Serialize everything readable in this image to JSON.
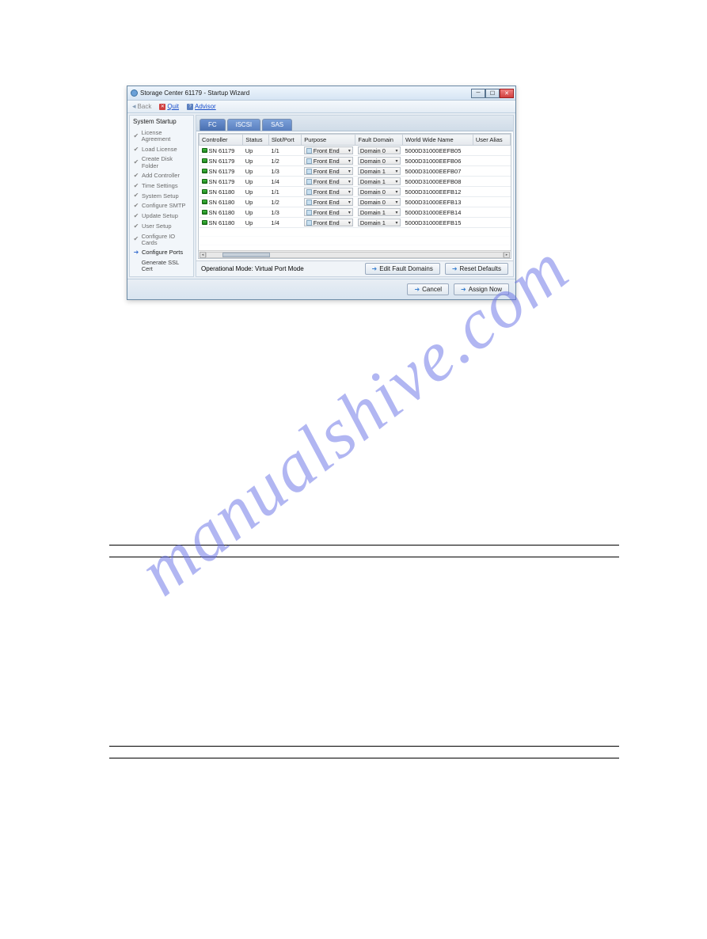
{
  "window": {
    "title": "Storage Center 61179 - Startup Wizard",
    "min": "─",
    "max": "☐",
    "close": "✕"
  },
  "toolbar": {
    "back": "Back",
    "quit": "Quit",
    "advisor": "Advisor"
  },
  "sidebar": {
    "title": "System Startup",
    "steps": [
      {
        "label": "License Agreement",
        "state": "done"
      },
      {
        "label": "Load License",
        "state": "done"
      },
      {
        "label": "Create Disk Folder",
        "state": "done"
      },
      {
        "label": "Add Controller",
        "state": "done"
      },
      {
        "label": "Time Settings",
        "state": "done"
      },
      {
        "label": "System Setup",
        "state": "done"
      },
      {
        "label": "Configure SMTP",
        "state": "done"
      },
      {
        "label": "Update Setup",
        "state": "done"
      },
      {
        "label": "User Setup",
        "state": "done"
      },
      {
        "label": "Configure IO Cards",
        "state": "done"
      },
      {
        "label": "Configure Ports",
        "state": "active"
      },
      {
        "label": "Generate SSL Cert",
        "state": "pending"
      }
    ]
  },
  "tabs": [
    {
      "label": "FC"
    },
    {
      "label": "iSCSI"
    },
    {
      "label": "SAS"
    }
  ],
  "columns": [
    "Controller",
    "Status",
    "Slot/Port",
    "Purpose",
    "Fault Domain",
    "World Wide Name",
    "User Alias"
  ],
  "rows": [
    {
      "controller": "SN 61179",
      "status": "Up",
      "slotport": "1/1",
      "purpose": "Front End",
      "fault": "Domain 0",
      "wwn": "5000D31000EEFB05",
      "alias": ""
    },
    {
      "controller": "SN 61179",
      "status": "Up",
      "slotport": "1/2",
      "purpose": "Front End",
      "fault": "Domain 0",
      "wwn": "5000D31000EEFB06",
      "alias": ""
    },
    {
      "controller": "SN 61179",
      "status": "Up",
      "slotport": "1/3",
      "purpose": "Front End",
      "fault": "Domain 1",
      "wwn": "5000D31000EEFB07",
      "alias": ""
    },
    {
      "controller": "SN 61179",
      "status": "Up",
      "slotport": "1/4",
      "purpose": "Front End",
      "fault": "Domain 1",
      "wwn": "5000D31000EEFB08",
      "alias": ""
    },
    {
      "controller": "SN 61180",
      "status": "Up",
      "slotport": "1/1",
      "purpose": "Front End",
      "fault": "Domain 0",
      "wwn": "5000D31000EEFB12",
      "alias": ""
    },
    {
      "controller": "SN 61180",
      "status": "Up",
      "slotport": "1/2",
      "purpose": "Front End",
      "fault": "Domain 0",
      "wwn": "5000D31000EEFB13",
      "alias": ""
    },
    {
      "controller": "SN 61180",
      "status": "Up",
      "slotport": "1/3",
      "purpose": "Front End",
      "fault": "Domain 1",
      "wwn": "5000D31000EEFB14",
      "alias": ""
    },
    {
      "controller": "SN 61180",
      "status": "Up",
      "slotport": "1/4",
      "purpose": "Front End",
      "fault": "Domain 1",
      "wwn": "5000D31000EEFB15",
      "alias": ""
    }
  ],
  "mode": {
    "label": "Operational Mode: Virtual Port Mode",
    "editFaultDomains": "Edit Fault Domains",
    "resetDefaults": "Reset Defaults"
  },
  "footer": {
    "cancel": "Cancel",
    "assignNow": "Assign Now"
  },
  "watermark": "manualshive.com"
}
